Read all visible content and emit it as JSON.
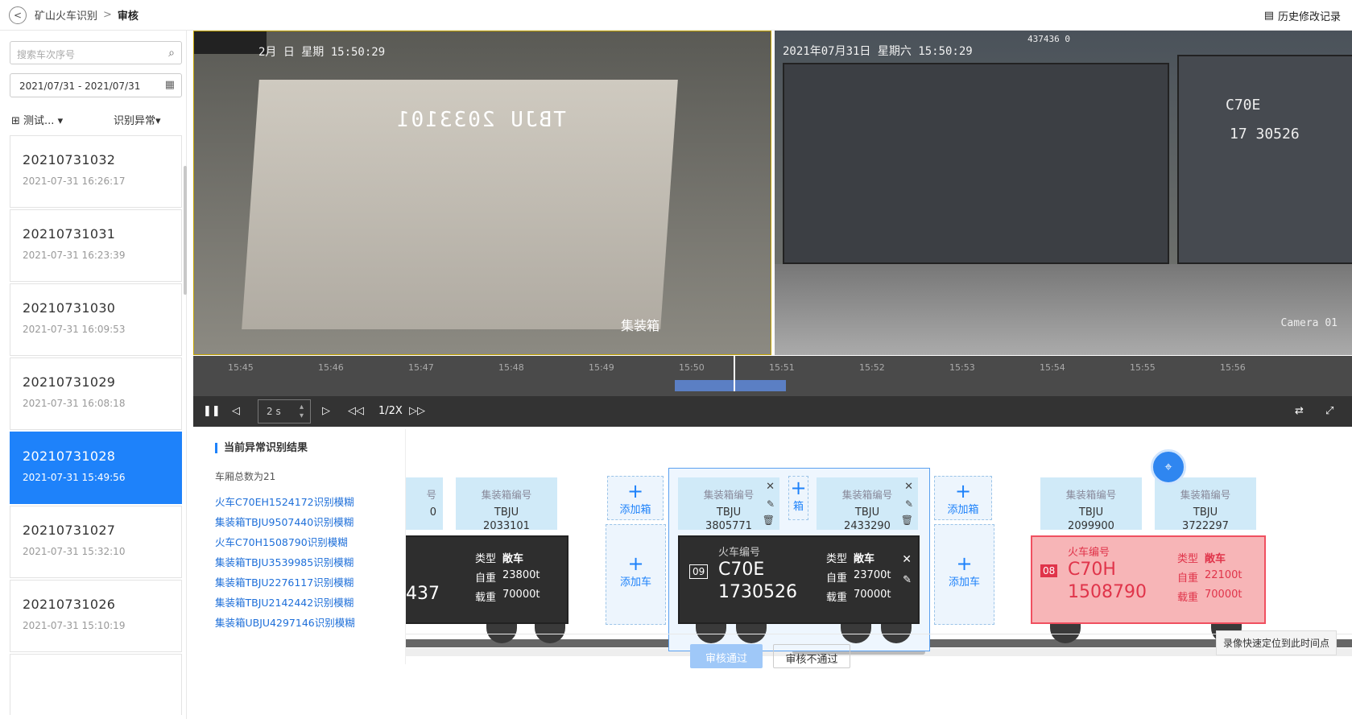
{
  "header": {
    "breadcrumb_parent": "矿山火车识别",
    "breadcrumb_sep": ">",
    "breadcrumb_current": "审核",
    "history": "历史修改记录"
  },
  "sidebar": {
    "search_placeholder": "搜索车次序号",
    "date_start": "2021/07/31",
    "date_sep": "-",
    "date_end": "2021/07/31",
    "filter1": "测试...",
    "filter2": "识别异常",
    "items": [
      {
        "id": "20210731032",
        "time": "2021-07-31 16:26:17"
      },
      {
        "id": "20210731031",
        "time": "2021-07-31 16:23:39"
      },
      {
        "id": "20210731030",
        "time": "2021-07-31 16:09:53"
      },
      {
        "id": "20210731029",
        "time": "2021-07-31 16:08:18"
      },
      {
        "id": "20210731028",
        "time": "2021-07-31 15:49:56"
      },
      {
        "id": "20210731027",
        "time": "2021-07-31 15:32:10"
      },
      {
        "id": "20210731026",
        "time": "2021-07-31 15:10:19"
      }
    ]
  },
  "video": {
    "left_timestamp": "2月   日  星期   15:50:29",
    "left_container_text": "TBJU 2033101",
    "left_label": "集装箱",
    "right_timestamp": "2021年07月31日  星期六  15:50:29",
    "right_camera": "Camera 01",
    "right_number": "437436 0",
    "right_model": "C70E",
    "right_serial": "17  30526"
  },
  "timeline": {
    "ticks": [
      "15:45",
      "15:46",
      "15:47",
      "15:48",
      "15:49",
      "15:50",
      "15:51",
      "15:52",
      "15:53",
      "15:54",
      "15:55",
      "15:56"
    ]
  },
  "controls": {
    "step": "2 s",
    "speed": "1/2X"
  },
  "abnormal": {
    "title": "当前异常识别结果",
    "count": "车厢总数为21",
    "items": [
      "火车C70EH1524172识别模糊",
      "集装箱TBJU9507440识别模糊",
      "火车C70H1508790识别模糊",
      "集装箱TBJU3539985识别模糊",
      "集装箱TBJU2276117识别模糊",
      "集装箱TBJU2142442识别模糊",
      "集装箱UBJU4297146识别模糊"
    ]
  },
  "train": {
    "box_header": "集装箱编号",
    "add_box": "添加箱",
    "add_car": "添加车",
    "box_short": "箱",
    "car_header": "火车编号",
    "type_label": "类型",
    "self_label": "自重",
    "load_label": "载重",
    "partial_box": {
      "h": "号",
      "v": "0"
    },
    "box_a": {
      "prefix": "TBJU",
      "number": "2033101"
    },
    "partial_car": {
      "num": "437",
      "type": "敞车",
      "self": "23800t",
      "load": "70000t"
    },
    "box_b": {
      "prefix": "TBJU",
      "number": "3805771"
    },
    "box_c": {
      "prefix": "TBJU",
      "number": "2433290"
    },
    "car_main": {
      "idx": "09",
      "model": "C70E",
      "number": "1730526",
      "type": "敞车",
      "self": "23700t",
      "load": "70000t"
    },
    "box_d": {
      "prefix": "TBJU",
      "number": "2099900"
    },
    "box_e": {
      "prefix": "TBJU",
      "number": "3722297"
    },
    "car_red": {
      "idx": "08",
      "model": "C70H",
      "number": "1508790",
      "type": "敞车",
      "self": "22100t",
      "load": "70000t"
    },
    "tooltip": "录像快速定位到此时间点"
  },
  "footer": {
    "approve": "审核通过",
    "reject": "审核不通过"
  },
  "colors": {
    "accent": "#1e82fa",
    "error": "#f05060"
  }
}
